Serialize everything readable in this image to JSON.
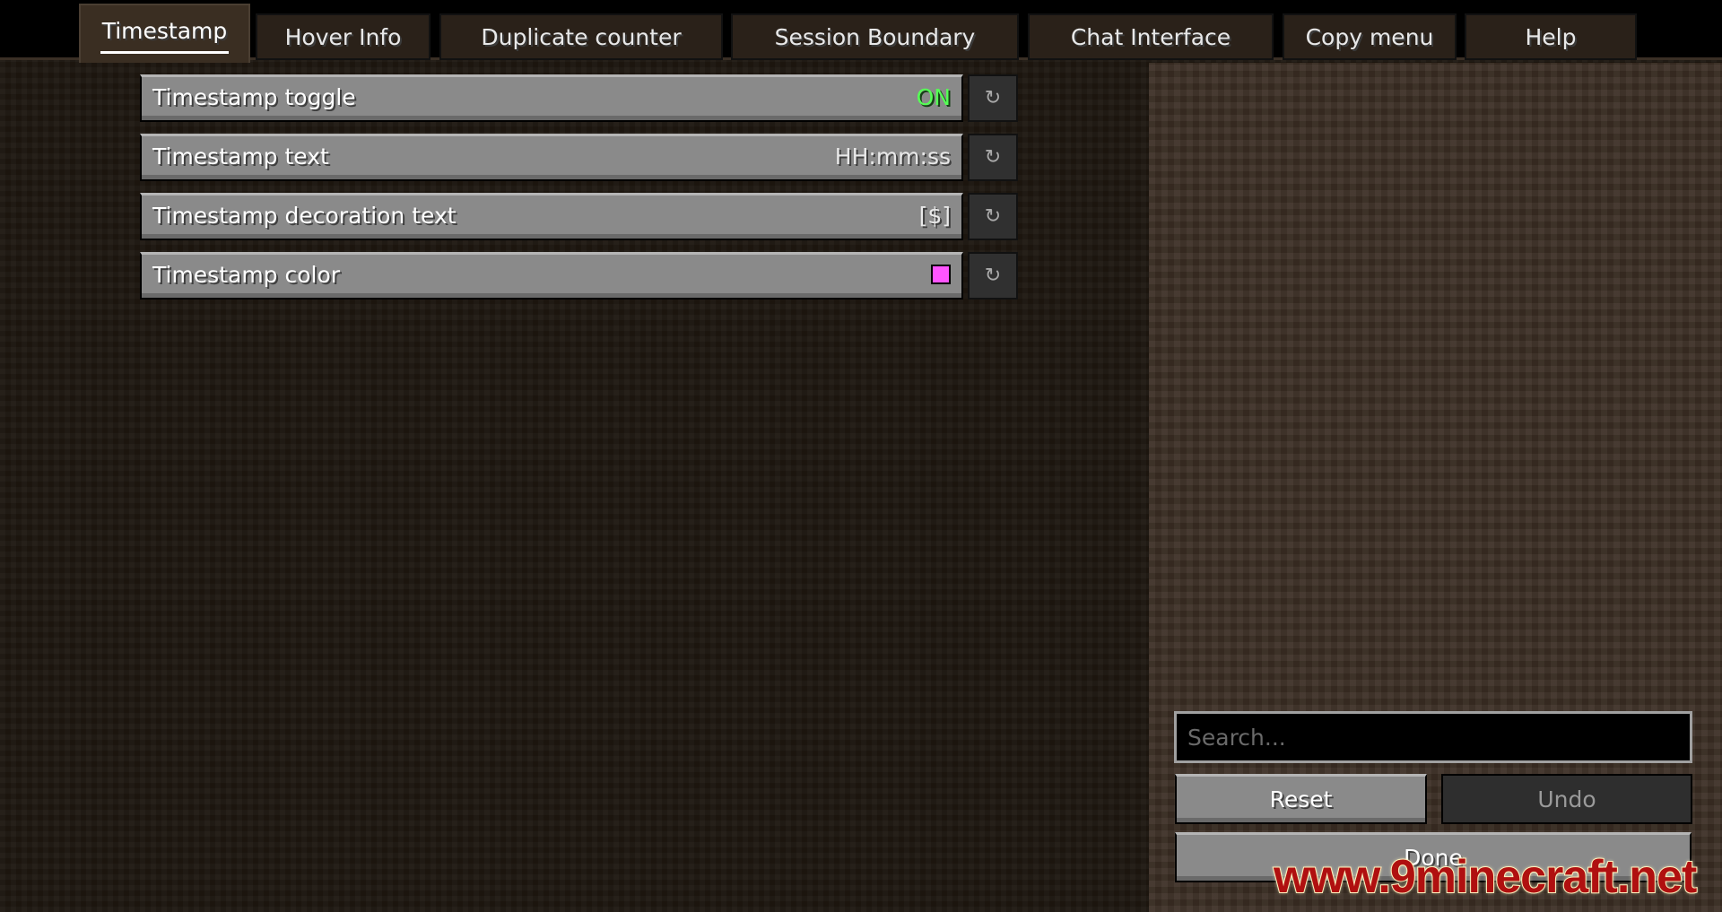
{
  "tabs": [
    {
      "label": "Timestamp",
      "active": true
    },
    {
      "label": "Hover Info"
    },
    {
      "label": "Duplicate counter"
    },
    {
      "label": "Session Boundary"
    },
    {
      "label": "Chat Interface"
    },
    {
      "label": "Copy menu"
    },
    {
      "label": "Help"
    }
  ],
  "options": [
    {
      "label": "Timestamp toggle",
      "value": "ON",
      "value_color": "#55ff55"
    },
    {
      "label": "Timestamp text",
      "value": "HH:mm:ss"
    },
    {
      "label": "Timestamp decoration text",
      "value": "[$]"
    },
    {
      "label": "Timestamp color",
      "color": "#ff55ff"
    }
  ],
  "reset_icon": "reset-arrow-icon",
  "search": {
    "placeholder": "Search..."
  },
  "buttons": {
    "reset": "Reset",
    "undo": "Undo",
    "done": "Done"
  },
  "watermark": "www.9minecraft.net"
}
